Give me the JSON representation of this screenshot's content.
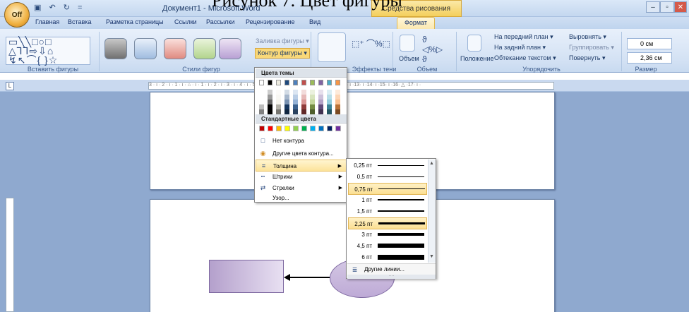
{
  "caption": "Рисунок 7. Цвет фигуры",
  "title_bar": {
    "window_title": "Документ1 - Microsoft Word",
    "context_tab_title": "Средства рисования",
    "quick_access": "▣ ↶ ↻ ="
  },
  "window_controls": {
    "minimize": "–",
    "maximize": "▫",
    "close": "✕"
  },
  "tabs": [
    "Главная",
    "Вставка",
    "Разметка страницы",
    "Ссылки",
    "Рассылки",
    "Рецензирование",
    "Вид",
    "Формат"
  ],
  "ribbon": {
    "groups": [
      "Вставить фигуры",
      "Стили фигур",
      "Эффекты тени",
      "Объем",
      "Упорядочить",
      "Размер"
    ],
    "shape_fill": "Заливка фигуры ▾",
    "shape_outline": "Контур фигуры ▾",
    "shadow_effects": "Эффекты тени",
    "volume": "Объем",
    "position": "Положение",
    "bring_front": "На передний план ▾",
    "send_back": "На задний план ▾",
    "text_wrap": "Обтекание текстом ▾",
    "align": "Выровнять ▾",
    "group": "Группировать ▾",
    "rotate": "Повернуть ▾",
    "height_value": "0 см",
    "width_value": "2,36 см"
  },
  "ruler_text": "3 · ı · 2 · ı · 1 · ı · ⌂ · ı · 1 · ı · 2 · ı · 3 · ı · 4 · ı · 5 · ı · 6 · ı · 7 · ı · 8 · ı · 9 · ı ·10· ı ·11· ı ·12· ı ·13· ı ·14· ı ·15· ı ·16· △ ·17· ı ·",
  "outline_menu": {
    "theme_colors_header": "Цвета темы",
    "standard_colors_header": "Стандартные цвета",
    "items": [
      "Нет контура",
      "Другие цвета контура...",
      "Толщина",
      "Штрихи",
      "Стрелки",
      "Узор..."
    ],
    "theme_colors": [
      "#ffffff",
      "#000000",
      "#eeece1",
      "#1f497d",
      "#4f81bd",
      "#c0504d",
      "#9bbb59",
      "#8064a2",
      "#4bacc6",
      "#f79646"
    ],
    "standard_colors": [
      "#c00000",
      "#ff0000",
      "#ffc000",
      "#ffff00",
      "#92d050",
      "#00b050",
      "#00b0f0",
      "#0070c0",
      "#002060",
      "#7030a0"
    ]
  },
  "weight_submenu": {
    "weights": [
      "0,25 пт",
      "0,5 пт",
      "0,75 пт",
      "1 пт",
      "1,5 пт",
      "2,25 пт",
      "3 пт",
      "4,5 пт",
      "6 пт"
    ],
    "more_lines": "Другие линии...",
    "highlighted": [
      "0,75 пт",
      "2,25 пт"
    ]
  }
}
